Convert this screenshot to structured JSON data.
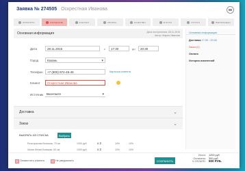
{
  "header": {
    "title": "Заявка № 274505",
    "subtitle": "Оскрестная Иванова"
  },
  "tabs": [
    {
      "label": "ОПЛАТИТЬ",
      "color": "#9e9e9e"
    },
    {
      "label": "ОЖИДАНИЕ",
      "color": "#e74c3c",
      "active": true
    },
    {
      "label": "КОНТАКТ",
      "color": "#9e9e9e"
    },
    {
      "label": "СБОРКА",
      "color": "#9e9e9e"
    },
    {
      "label": "КАЧЕСТВО",
      "color": "#9e9e9e"
    },
    {
      "label": "В ПУТИ",
      "color": "#9e9e9e"
    },
    {
      "label": "ОТГРУЗ",
      "color": "#9e9e9e"
    },
    {
      "label": "ВЫПОЛНЕНО",
      "color": "#9e9e9e"
    }
  ],
  "main_info": {
    "title": "Основная информация",
    "meta_line1": "Дата поступления: 28.11.2015",
    "meta_line2": "Автор: Мария Иванова"
  },
  "form": {
    "date_label": "Дата",
    "date_value": "28.11.2015",
    "from_sep": "с",
    "time_from": "17:30",
    "to_sep": "до",
    "time_to": "20:30",
    "city_label": "Город",
    "city_value": "Казань",
    "phone_label": "Телефон",
    "phone_value": "+7 (900) 874-45-45",
    "phone_link": "Карточка клиента",
    "client_label": "Клиент",
    "client_value": "Оскрестная Иванова",
    "source_label": "Источник",
    "source_value": "Вконтакте"
  },
  "sections": {
    "delivery": "Доставка",
    "order": "Заказ"
  },
  "pick": {
    "title": "ВЫБРАТЬ ИЗ СПИСКА",
    "button": "Выбрать"
  },
  "products": [
    {
      "name": "Роза красная большая, 70 см",
      "price": "1000 руб.",
      "qty": "x 2",
      "pct1": "10%",
      "pct2": "10%"
    },
    {
      "name": "Лилия белая большая, 60 см",
      "price": "1000 руб.",
      "qty": "x 2",
      "pct1": "10%",
      "pct2": "10%"
    }
  ],
  "side": {
    "item_head": "Основная информация",
    "delivery_label": "Доставка",
    "delivery_time": "17:30 - 20:30",
    "order_label": "Заказ",
    "order_count": "(2)",
    "payment_label": "Оплата",
    "history_label": "История изменений"
  },
  "footer": {
    "notify_client": "Оповестить клиента",
    "not_notify": "Не уведомлять",
    "save": "СОХРАНИТЬ",
    "total_label": "Итого:",
    "total_value": "1200 руб",
    "paid_label": "Оплачено:",
    "paid_value": "300 руб",
    "due_label": "К ОПЛАТЕ:",
    "due_value": "900 РУБ."
  }
}
